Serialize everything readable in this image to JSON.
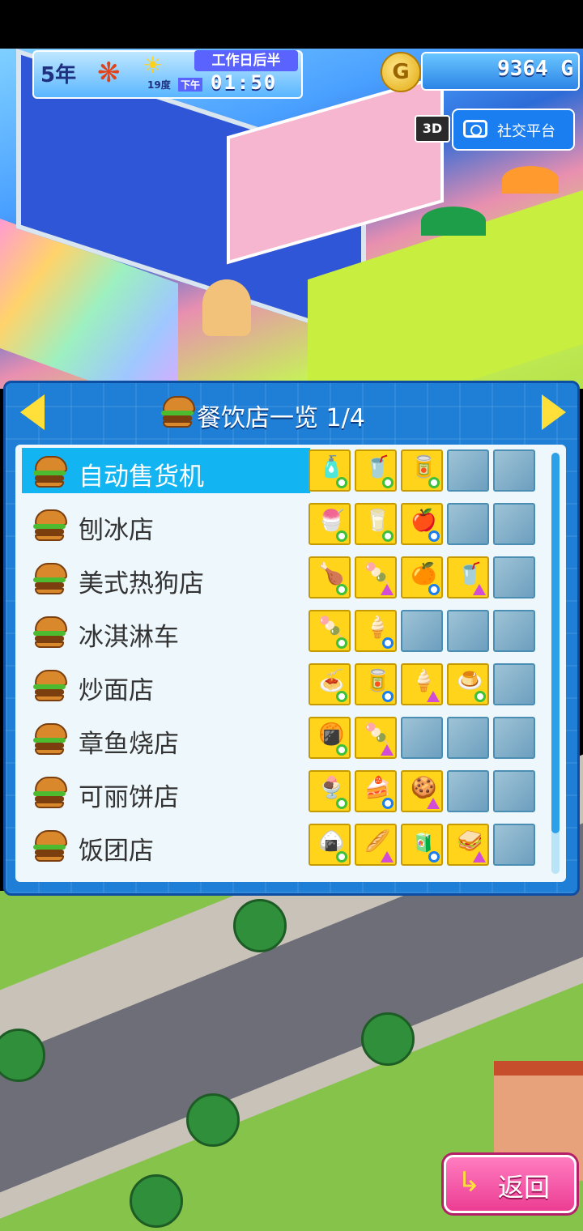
{
  "hud": {
    "year": "5年",
    "temperature": "19度",
    "period": "工作日后半",
    "ampm": "下午",
    "time": "01:50",
    "money": "9364 G",
    "coin_label": "G",
    "view_3d": "3D",
    "social_label": "社交平台"
  },
  "panel": {
    "title": "餐饮店一览 1/4",
    "rows": [
      {
        "name": "自动售货机",
        "selected": true,
        "slots": [
          {
            "icon": "🧴",
            "tag": "green"
          },
          {
            "icon": "🥤",
            "tag": "green"
          },
          {
            "icon": "🥫",
            "tag": "green"
          },
          null,
          null
        ]
      },
      {
        "name": "刨冰店",
        "selected": false,
        "slots": [
          {
            "icon": "🍧",
            "tag": "green"
          },
          {
            "icon": "🥛",
            "tag": "green"
          },
          {
            "icon": "🍎",
            "tag": "blue"
          },
          null,
          null
        ]
      },
      {
        "name": "美式热狗店",
        "selected": false,
        "slots": [
          {
            "icon": "🍗",
            "tag": "green"
          },
          {
            "icon": "🍡",
            "tag": "tri"
          },
          {
            "icon": "🍊",
            "tag": "blue"
          },
          {
            "icon": "🥤",
            "tag": "tri"
          },
          null
        ]
      },
      {
        "name": "冰淇淋车",
        "selected": false,
        "slots": [
          {
            "icon": "🍡",
            "tag": "green"
          },
          {
            "icon": "🍦",
            "tag": "blue"
          },
          null,
          null,
          null
        ]
      },
      {
        "name": "炒面店",
        "selected": false,
        "slots": [
          {
            "icon": "🍝",
            "tag": "green"
          },
          {
            "icon": "🥫",
            "tag": "blue"
          },
          {
            "icon": "🍦",
            "tag": "tri"
          },
          {
            "icon": "🍮",
            "tag": "green"
          },
          null
        ]
      },
      {
        "name": "章鱼烧店",
        "selected": false,
        "slots": [
          {
            "icon": "🍘",
            "tag": "green"
          },
          {
            "icon": "🍡",
            "tag": "tri"
          },
          null,
          null,
          null
        ]
      },
      {
        "name": "可丽饼店",
        "selected": false,
        "slots": [
          {
            "icon": "🍨",
            "tag": "green"
          },
          {
            "icon": "🍰",
            "tag": "blue"
          },
          {
            "icon": "🍪",
            "tag": "tri"
          },
          null,
          null
        ]
      },
      {
        "name": "饭团店",
        "selected": false,
        "slots": [
          {
            "icon": "🍙",
            "tag": "green"
          },
          {
            "icon": "🥖",
            "tag": "tri"
          },
          {
            "icon": "🧃",
            "tag": "blue"
          },
          {
            "icon": "🥪",
            "tag": "tri"
          },
          null
        ]
      }
    ]
  },
  "back_button": {
    "label": "返回",
    "icon": "return-arrow-icon"
  },
  "colors": {
    "panel": "#1f7fd6",
    "selected_row": "#12b5f2",
    "slot_filled": "#ffd41a",
    "back_button": "#ec3d93"
  }
}
